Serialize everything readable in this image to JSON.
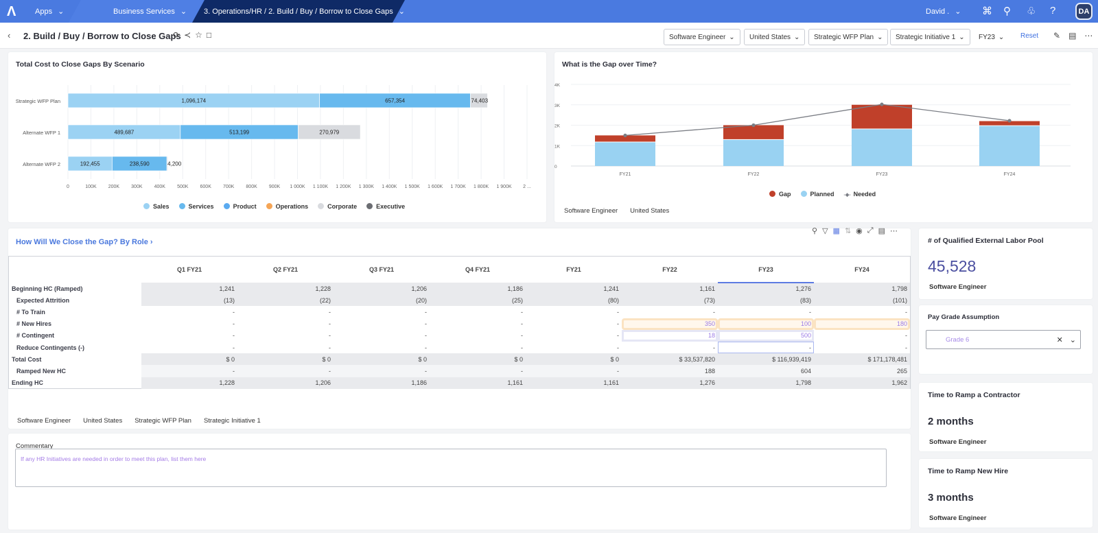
{
  "topbar": {
    "logo_icon": "anaplan-logo",
    "apps_label": "Apps",
    "workspace_label": "Business Services",
    "page_path_label": "3. Operations/HR / 2. Build / Buy / Borrow to Close Gaps",
    "user_name": "David .",
    "avatar_initials": "DA",
    "icons": [
      "apps-grid-icon",
      "search-icon",
      "bell-icon",
      "help-icon"
    ]
  },
  "subbar": {
    "title": "2. Build / Buy / Borrow to Close Gaps",
    "filters": [
      "Software Engineer",
      "United States",
      "Strategic WFP Plan",
      "Strategic Initiative 1",
      "FY23"
    ],
    "reset_label": "Reset"
  },
  "cost_card": {
    "title": "Total Cost to Close Gaps By Scenario"
  },
  "gap_card": {
    "title": "What is the Gap over Time?",
    "tags": [
      "Software Engineer",
      "United States"
    ]
  },
  "chart_data": [
    {
      "type": "bar",
      "orientation": "horizontal",
      "stacked": true,
      "title": "Total Cost to Close Gaps By Scenario",
      "categories": [
        "Strategic WFP Plan",
        "Alternate WFP 1",
        "Alternate WFP 2"
      ],
      "series": [
        {
          "name": "Sales",
          "color": "#9bd2f3",
          "values": [
            1096174,
            489687,
            192455
          ]
        },
        {
          "name": "Services",
          "color": "#67b9ee",
          "values": [
            657354,
            513199,
            238590
          ]
        },
        {
          "name": "Product",
          "color": "#5aaaf0",
          "values": [
            0,
            0,
            0
          ]
        },
        {
          "name": "Operations",
          "color": "#f5a556",
          "values": [
            0,
            0,
            0
          ]
        },
        {
          "name": "Corporate",
          "color": "#d9dbdf",
          "values": [
            74403,
            270979,
            4200
          ]
        },
        {
          "name": "Executive",
          "color": "#6b6d72",
          "values": [
            0,
            0,
            0
          ]
        }
      ],
      "data_labels": [
        [
          "1,096,174",
          "657,354",
          "74,403"
        ],
        [
          "489,687",
          "513,199",
          "270,979"
        ],
        [
          "192,455",
          "238,590",
          "4,200"
        ]
      ],
      "xlim": [
        0,
        2000000
      ],
      "xticks": [
        "0",
        "100K",
        "200K",
        "300K",
        "400K",
        "500K",
        "600K",
        "700K",
        "800K",
        "900K",
        "1 000K",
        "1 100K",
        "1 200K",
        "1 300K",
        "1 400K",
        "1 500K",
        "1 600K",
        "1 700K",
        "1 800K",
        "1 900K",
        "2 ..."
      ],
      "grid": true,
      "legend": "bottom"
    },
    {
      "type": "bar",
      "stacked": true,
      "combo_line": true,
      "title": "What is the Gap over Time?",
      "categories": [
        "FY21",
        "FY22",
        "FY23",
        "FY24"
      ],
      "series": [
        {
          "name": "Planned",
          "type": "bar",
          "color": "#99d2f2",
          "values": [
            1160,
            1280,
            1800,
            1960
          ]
        },
        {
          "name": "Gap",
          "type": "bar",
          "color": "#c0402a",
          "values": [
            340,
            720,
            1200,
            240
          ]
        },
        {
          "name": "Needed",
          "type": "line",
          "color": "#7b7e85",
          "values": [
            1500,
            2000,
            3020,
            2220
          ]
        }
      ],
      "legend_order": [
        "Gap",
        "Planned",
        "Needed"
      ],
      "ylim": [
        0,
        4000
      ],
      "yticks": [
        "0",
        "1K",
        "2K",
        "3K",
        "4K"
      ],
      "grid": true,
      "legend": "bottom"
    }
  ],
  "table_card": {
    "title": "How Will We Close the Gap? By Role",
    "toolbar_icons": [
      "search-icon",
      "filter-icon",
      "pivot-icon",
      "sort-icon",
      "eye-icon",
      "expand-icon",
      "comment-icon",
      "more-icon"
    ],
    "columns": [
      "Q1 FY21",
      "Q2 FY21",
      "Q3 FY21",
      "Q4 FY21",
      "FY21",
      "FY22",
      "FY23",
      "FY24"
    ],
    "rows": [
      {
        "label": "Beginning HC (Ramped)",
        "indent": false,
        "values": [
          "1,241",
          "1,228",
          "1,206",
          "1,186",
          "1,241",
          "1,161",
          "1,276",
          "1,798"
        ]
      },
      {
        "label": "Expected Attrition",
        "indent": true,
        "values": [
          "(13)",
          "(22)",
          "(20)",
          "(25)",
          "(80)",
          "(73)",
          "(83)",
          "(101)"
        ]
      },
      {
        "label": "# To Train",
        "indent": true,
        "values": [
          "-",
          "-",
          "-",
          "-",
          "-",
          "-",
          "-",
          "-"
        ]
      },
      {
        "label": "# New Hires",
        "indent": true,
        "values": [
          "-",
          "-",
          "-",
          "-",
          "-",
          "350",
          "100",
          "180"
        ]
      },
      {
        "label": "# Contingent",
        "indent": true,
        "values": [
          "-",
          "-",
          "-",
          "-",
          "-",
          "18",
          "500",
          "-"
        ]
      },
      {
        "label": "Reduce Contingents (-)",
        "indent": true,
        "values": [
          "-",
          "-",
          "-",
          "-",
          "-",
          "-",
          "-",
          "-"
        ]
      },
      {
        "label": "Total Cost",
        "indent": false,
        "values": [
          "$ 0",
          "$ 0",
          "$ 0",
          "$ 0",
          "$ 0",
          "$ 33,537,820",
          "$ 116,939,419",
          "$ 171,178,481"
        ]
      },
      {
        "label": "Ramped New HC",
        "indent": true,
        "values": [
          "-",
          "-",
          "-",
          "-",
          "-",
          "188",
          "604",
          "265"
        ]
      },
      {
        "label": "Ending HC",
        "indent": false,
        "values": [
          "1,228",
          "1,206",
          "1,186",
          "1,161",
          "1,161",
          "1,276",
          "1,798",
          "1,962"
        ]
      }
    ],
    "tags": [
      "Software Engineer",
      "United States",
      "Strategic WFP Plan",
      "Strategic Initiative 1"
    ]
  },
  "commentary": {
    "label": "Commentary",
    "placeholder": "If any HR Initiatives are needed in order to meet this plan, list them here"
  },
  "labor_pool": {
    "title": "# of Qualified External Labor Pool",
    "value": "45,528",
    "subtitle": "Software Engineer"
  },
  "pay_grade": {
    "label": "Pay Grade Assumption",
    "value": "Grade 6"
  },
  "ramp_contractor": {
    "title": "Time to Ramp a Contractor",
    "value": "2 months",
    "subtitle": "Software Engineer"
  },
  "ramp_new_hire": {
    "title": "Time to Ramp New Hire",
    "value": "3 months",
    "subtitle": "Software Engineer"
  }
}
